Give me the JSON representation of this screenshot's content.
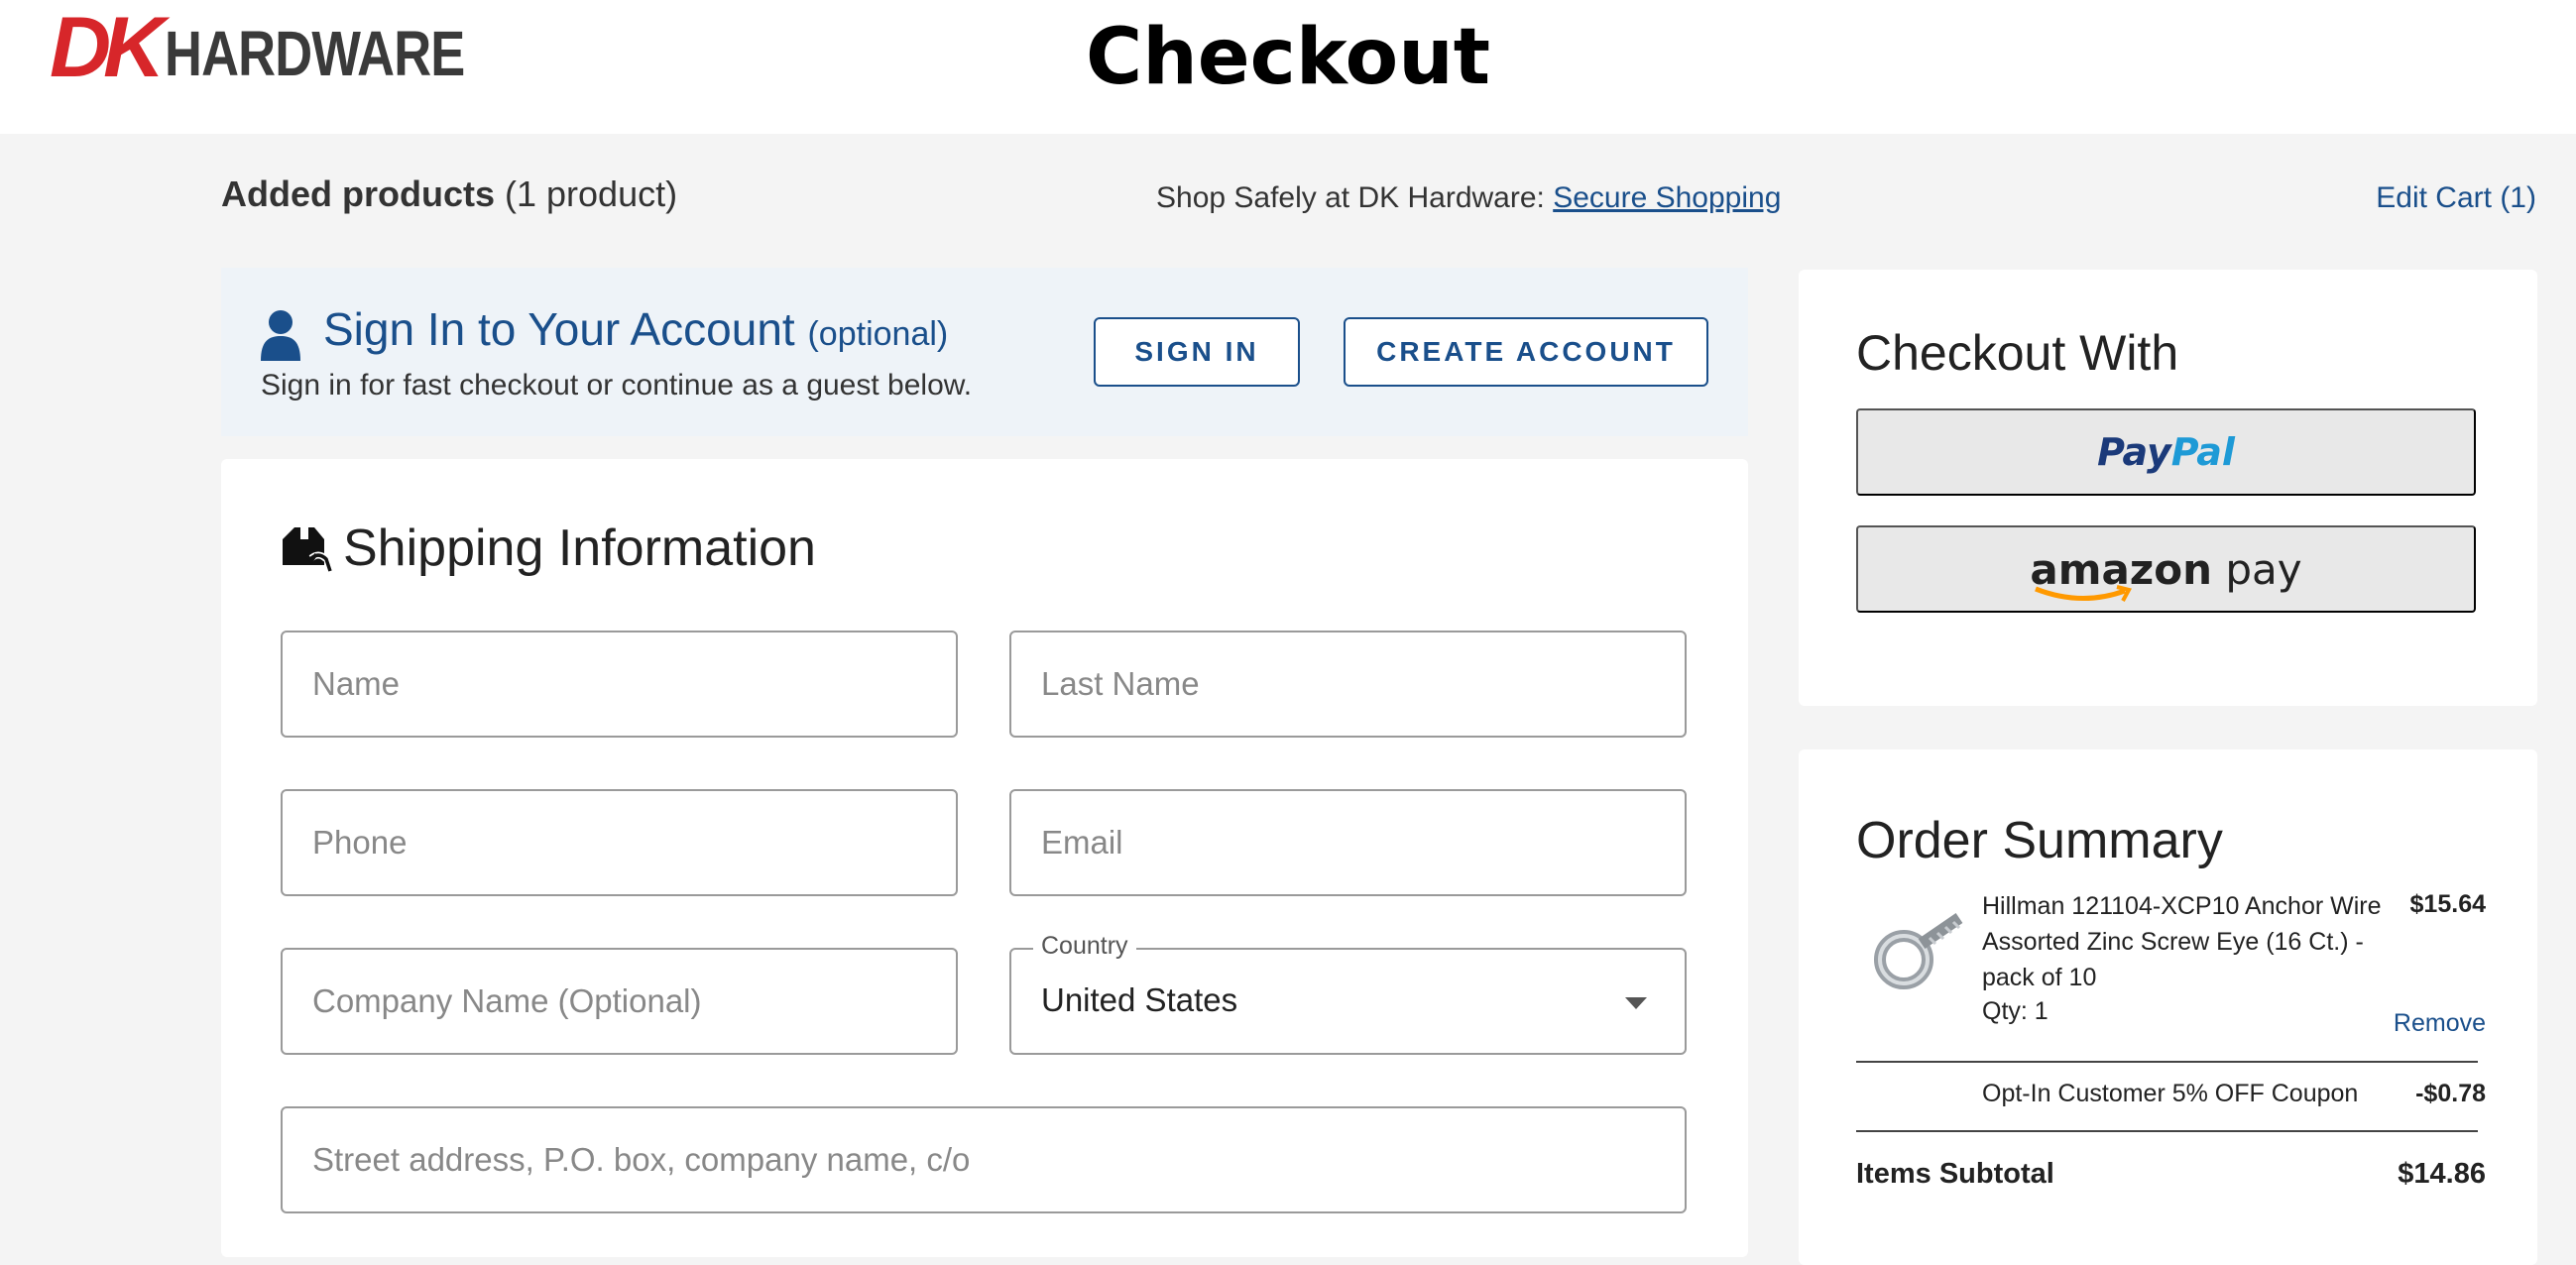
{
  "header": {
    "logo_dk": "DK",
    "logo_hardware": "HARDWARE",
    "title": "Checkout"
  },
  "topbar": {
    "added_bold": "Added products",
    "added_count": "(1 product)",
    "shop_safely": "Shop Safely at DK Hardware:",
    "secure_link": "Secure Shopping",
    "edit_cart": "Edit Cart (1)"
  },
  "signin": {
    "title": "Sign In to Your Account",
    "optional": "(optional)",
    "subtitle": "Sign in for fast checkout or continue as a guest below.",
    "signin_button": "SIGN IN",
    "create_button": "CREATE ACCOUNT",
    "icon": "person-icon"
  },
  "shipping": {
    "title": "Shipping Information",
    "icon": "shipping-box-icon",
    "name_placeholder": "Name",
    "last_name_placeholder": "Last Name",
    "phone_placeholder": "Phone",
    "email_placeholder": "Email",
    "company_placeholder": "Company Name (Optional)",
    "country_label": "Country",
    "country_value": "United States",
    "street_placeholder": "Street address, P.O. box, company name, c/o"
  },
  "checkout_with": {
    "title": "Checkout With",
    "paypal_part1": "Pay",
    "paypal_part2": "Pal",
    "amazon_part1": "amazon",
    "amazon_part2": " pay"
  },
  "order_summary": {
    "title": "Order Summary",
    "item": {
      "name": "Hillman 121104-XCP10 Anchor Wire Assorted Zinc Screw Eye (16 Ct.) - pack of 10",
      "qty": "Qty: 1",
      "price": "$15.64",
      "remove": "Remove"
    },
    "coupon": {
      "name": "Opt-In Customer 5% OFF Coupon",
      "amount": "-$0.78"
    },
    "subtotal_label": "Items Subtotal",
    "subtotal_value": "$14.86"
  },
  "colors": {
    "brand_red": "#d7262a",
    "link_blue": "#1a4f8b",
    "paypal_dark": "#1b3a7a",
    "paypal_light": "#1e9ad6",
    "amazon_orange": "#f90"
  }
}
